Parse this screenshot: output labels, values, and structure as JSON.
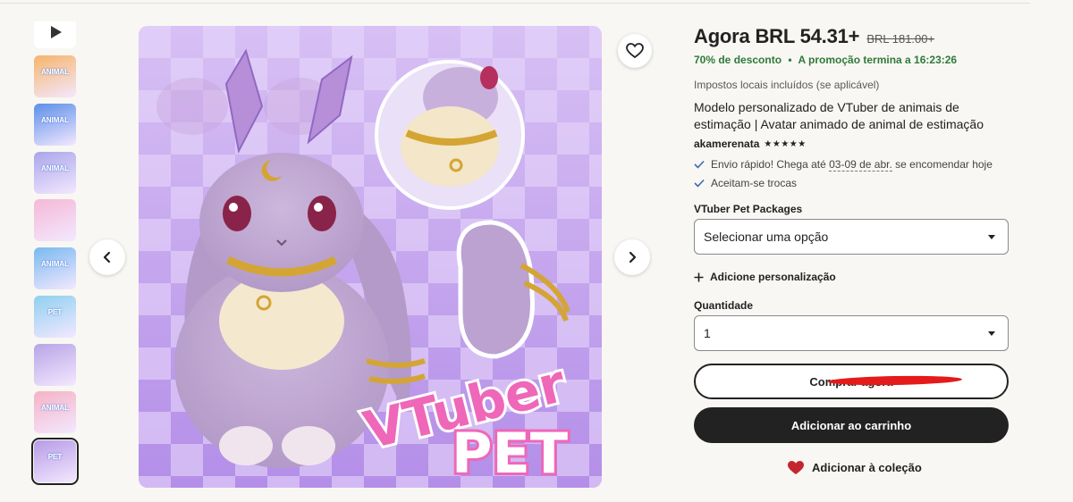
{
  "gallery": {
    "thumbnails": [
      {
        "kind": "video",
        "label": ""
      },
      {
        "kind": "image",
        "label": "ANIMAL",
        "bg": "#f7b46a"
      },
      {
        "kind": "image",
        "label": "ANIMAL",
        "bg": "#5b8fe8"
      },
      {
        "kind": "image",
        "label": "ANIMAL",
        "bg": "#a9a6ea"
      },
      {
        "kind": "image",
        "label": "",
        "bg": "#f5b8d6"
      },
      {
        "kind": "image",
        "label": "ANIMAL",
        "bg": "#79b9ef"
      },
      {
        "kind": "image",
        "label": "PET",
        "bg": "#8fd0f0"
      },
      {
        "kind": "image",
        "label": "",
        "bg": "#b7a4e6"
      },
      {
        "kind": "image",
        "label": "ANIMAL",
        "bg": "#f5b2c4"
      },
      {
        "kind": "image",
        "label": "PET",
        "bg": "#b79be6"
      }
    ],
    "main_image": {
      "title_line1": "VTuber",
      "title_line2": "PET",
      "subject": "lavender bunny vtuber pet"
    }
  },
  "product": {
    "price_now": "Agora BRL 54.31+",
    "price_old": "BRL 181.00+",
    "discount": "70% de desconto",
    "promo_sep": "•",
    "promo_text": "A promoção termina a 16:23:26",
    "taxes": "Impostos locais incluídos (se aplicável)",
    "title": "Modelo personalizado de VTuber de animais de estimação | Avatar animado de animal de estimação",
    "shop_name": "akamerenata",
    "rating_stars": "★★★★★",
    "features": {
      "shipping_prefix": "Envio rápido! Chega até ",
      "shipping_dates": "03-09 de abr.",
      "shipping_suffix": " se encomendar hoje",
      "returns": "Aceitam-se trocas"
    },
    "variation_label": "VTuber Pet Packages",
    "variation_value": "Selecionar uma opção",
    "personalization": "Adicione personalização",
    "quantity_label": "Quantidade",
    "quantity_value": "1",
    "buy_now": "Comprar agora",
    "add_to_cart": "Adicionar ao carrinho",
    "add_collection": "Adicionar à coleção"
  },
  "colors": {
    "promo_green": "#2f7a3a",
    "heart_red": "#c4262d",
    "dark_button": "#222222",
    "bg_purple": "#c7a6f0"
  }
}
